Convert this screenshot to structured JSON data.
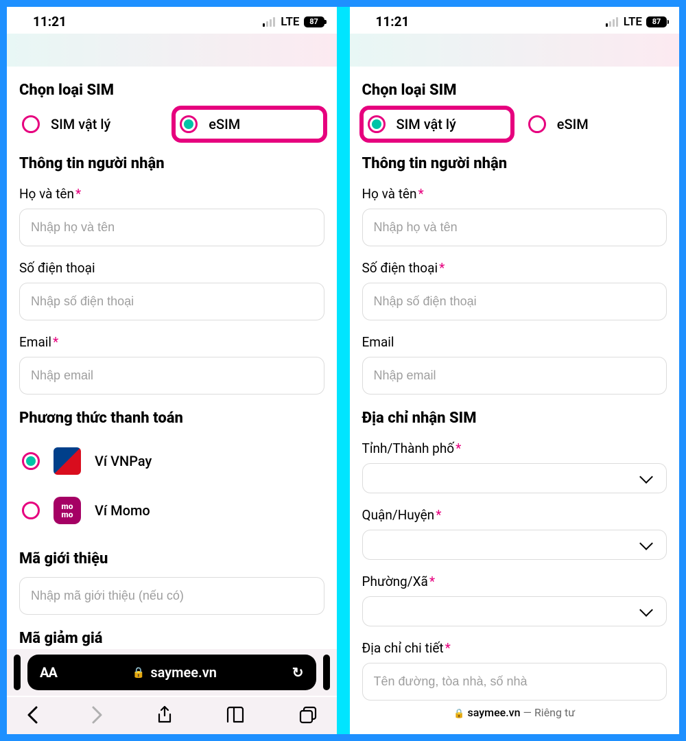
{
  "status": {
    "time": "11:21",
    "network": "LTE",
    "battery": "87"
  },
  "left": {
    "sim_section": "Chọn loại SIM",
    "sim_physical": "SIM vật lý",
    "sim_esim": "eSIM",
    "recipient_section": "Thông tin người nhận",
    "name_label": "Họ và tên",
    "name_ph": "Nhập họ và tên",
    "phone_label": "Số điện thoại",
    "phone_ph": "Nhập số điện thoại",
    "email_label": "Email",
    "email_ph": "Nhập email",
    "payment_section": "Phương thức thanh toán",
    "vnpay": "Ví VNPay",
    "momo": "Ví Momo",
    "referral_section": "Mã giới thiệu",
    "referral_ph": "Nhập mã giới thiệu (nếu có)",
    "discount_section": "Mã giảm giá",
    "url": "saymee.vn",
    "aa": "AA"
  },
  "right": {
    "sim_section": "Chọn loại SIM",
    "sim_physical": "SIM vật lý",
    "sim_esim": "eSIM",
    "recipient_section": "Thông tin người nhận",
    "name_label": "Họ và tên",
    "name_ph": "Nhập họ và tên",
    "phone_label": "Số điện thoại",
    "phone_ph": "Nhập số điện thoại",
    "email_label": "Email",
    "email_ph": "Nhập email",
    "address_section": "Địa chỉ nhận SIM",
    "province_label": "Tỉnh/Thành phố",
    "district_label": "Quận/Huyện",
    "ward_label": "Phường/Xã",
    "detail_label": "Địa chỉ chi tiết",
    "detail_ph": "Tên đường, tòa nhà, số nhà",
    "url": "saymee.vn",
    "private": "Riêng tư"
  }
}
